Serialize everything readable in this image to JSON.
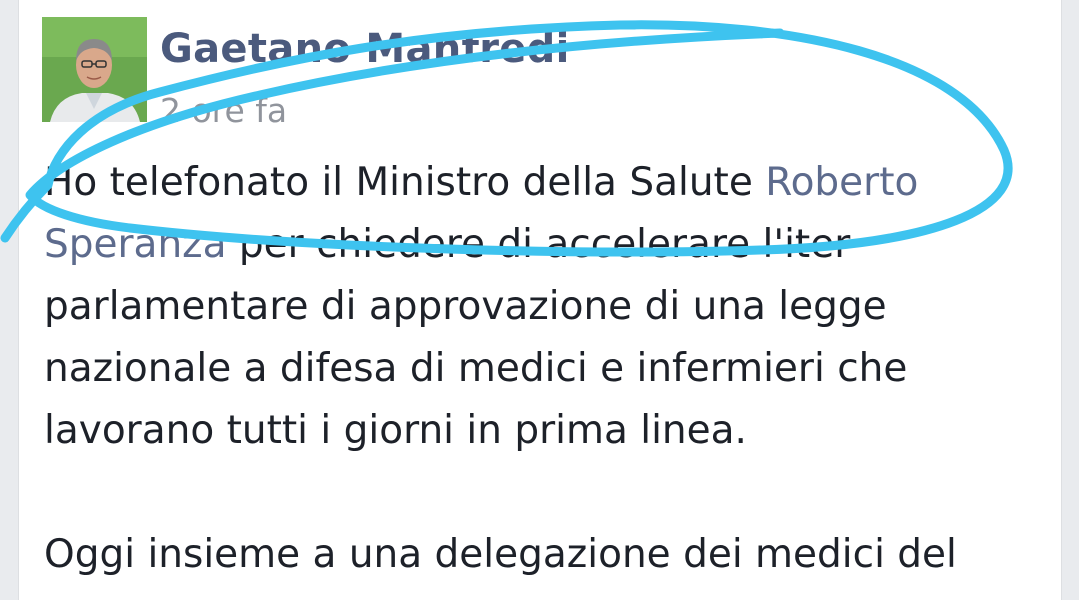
{
  "post": {
    "author": "Gaetano Manfredi",
    "timestamp": "2 ore fa",
    "avatar_icon": "profile-photo",
    "body": {
      "line1_text": "Ho telefonato il Ministro della Salute ",
      "line1_link": "Roberto",
      "line2_link": "Speranza",
      "line2_text": " per chiedere di accelerare l'iter",
      "line3": "parlamentare di approvazione di una legge",
      "line4": "nazionale a difesa di medici e infermieri che",
      "line5": "lavorano tutti i giorni in prima linea.",
      "line6": "Oggi insieme a una delegazione dei medici del"
    }
  },
  "colors": {
    "author": "#4b5a7d",
    "link": "#5d6b8d",
    "timestamp": "#90949c",
    "text": "#1d2129",
    "annotation": "#3ec3ef"
  }
}
